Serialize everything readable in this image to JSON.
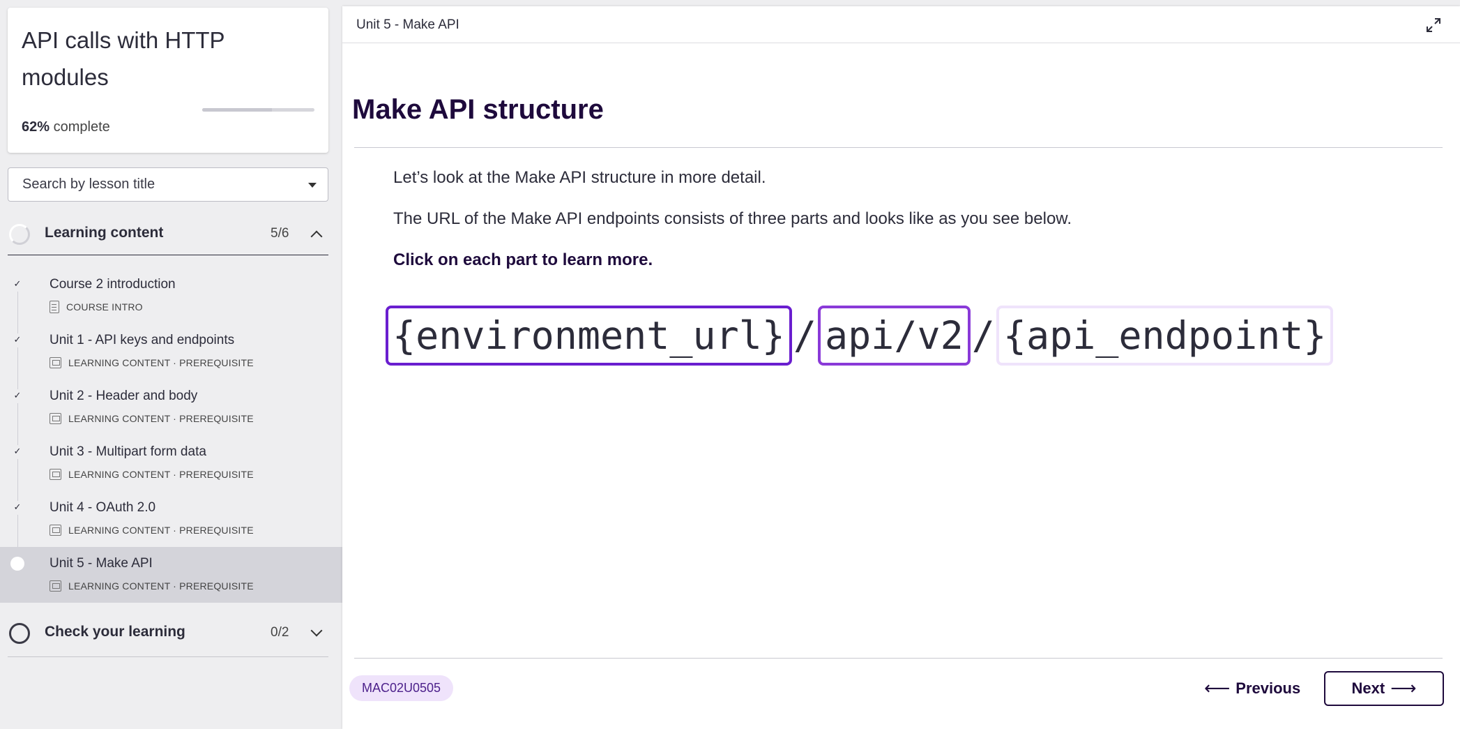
{
  "course": {
    "title": "API calls with HTTP modules",
    "progress_percent": 62,
    "progress_value": "62%",
    "progress_suffix": "complete"
  },
  "search": {
    "label": "Search by lesson title"
  },
  "sections": [
    {
      "title": "Learning content",
      "count": "5/6",
      "expanded": true,
      "lessons": [
        {
          "title": "Course 2 introduction",
          "meta": "COURSE INTRO",
          "icon": "document-icon",
          "done": true
        },
        {
          "title": "Unit 1 - API keys and endpoints",
          "meta": "LEARNING CONTENT · PREREQUISITE",
          "icon": "screen-icon",
          "done": true
        },
        {
          "title": "Unit 2 - Header and body",
          "meta": "LEARNING CONTENT · PREREQUISITE",
          "icon": "screen-icon",
          "done": true
        },
        {
          "title": "Unit 3 - Multipart form data",
          "meta": "LEARNING CONTENT · PREREQUISITE",
          "icon": "screen-icon",
          "done": true
        },
        {
          "title": "Unit 4 - OAuth 2.0",
          "meta": "LEARNING CONTENT · PREREQUISITE",
          "icon": "screen-icon",
          "done": true
        },
        {
          "title": "Unit 5 - Make API",
          "meta": "LEARNING CONTENT · PREREQUISITE",
          "icon": "screen-icon",
          "done": false,
          "active": true
        }
      ]
    },
    {
      "title": "Check your learning",
      "count": "0/2",
      "expanded": false
    }
  ],
  "main": {
    "breadcrumb": "Unit 5 - Make API",
    "title": "Make API structure",
    "paragraphs": [
      "Let’s look at the Make API structure in more detail.",
      "The URL of the Make API endpoints consists of three parts and looks like as you see below.",
      "Click on each part to learn more."
    ],
    "url_parts": {
      "environment": "{environment_url}",
      "separator": "/",
      "api_version": "api/v2",
      "endpoint": "{api_endpoint}"
    }
  },
  "footer": {
    "lesson_code": "MAC02U0505",
    "previous_label": "Previous",
    "next_label": "Next"
  },
  "colors": {
    "brand_dark": "#1e0a3c",
    "accent_purple": "#6a1ecf",
    "badge_bg": "#efe3fb"
  }
}
